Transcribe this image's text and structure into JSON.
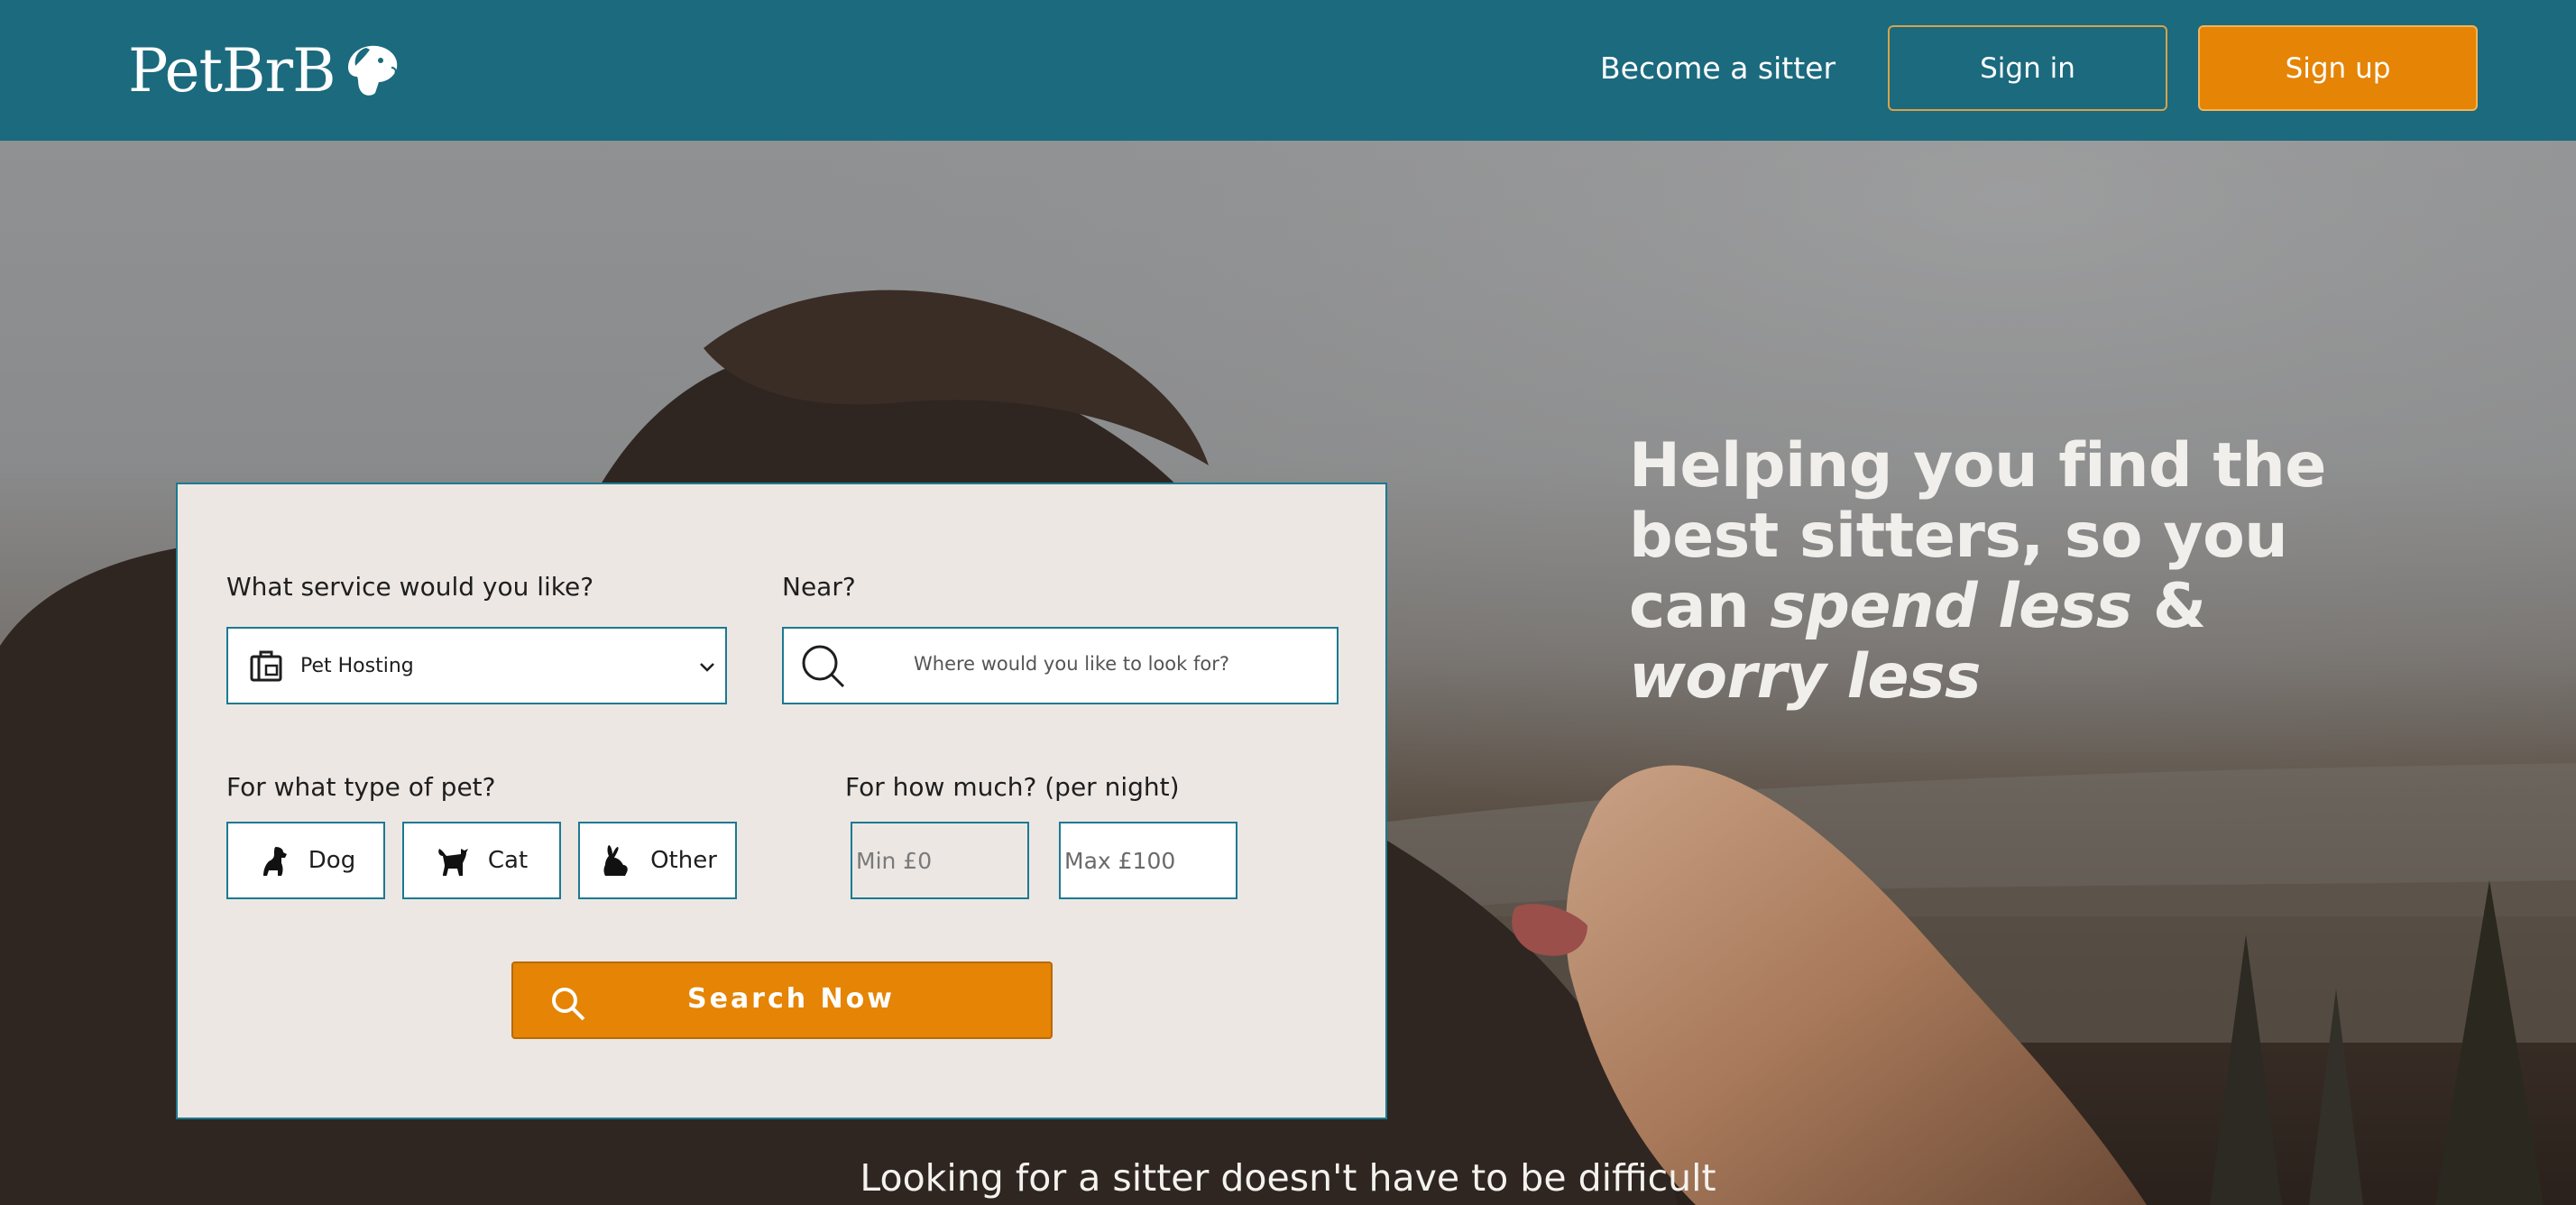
{
  "header": {
    "logo_text": "PetBrB",
    "logo_icon": "dog-head-icon",
    "become_label": "Become a sitter",
    "signin_label": "Sign in",
    "signup_label": "Sign up"
  },
  "search_form": {
    "service_label": "What service would you like?",
    "service_value": "Pet Hosting",
    "near_label": "Near?",
    "near_placeholder": "Where would you like to look for?",
    "pet_type_label": "For what type of pet?",
    "pets": [
      {
        "label": "Dog",
        "icon": "dog-icon"
      },
      {
        "label": "Cat",
        "icon": "cat-icon"
      },
      {
        "label": "Other",
        "icon": "rabbit-icon"
      }
    ],
    "price_label": "For how much? (per night)",
    "min_placeholder": "Min £0",
    "max_placeholder": "Max £100",
    "search_label": "Search Now"
  },
  "hero": {
    "tagline_part1": "Helping you find the best sitters, so you can ",
    "tagline_em1": "spend less",
    "tagline_amp": " & ",
    "tagline_em2": "worry less",
    "bottom_text": "Looking for a sitter doesn't have to be difficult"
  },
  "colors": {
    "header_bg": "#1b6a7e",
    "accent_orange": "#e58405",
    "card_bg": "#ece7e3",
    "border_teal": "#1b7a92"
  }
}
